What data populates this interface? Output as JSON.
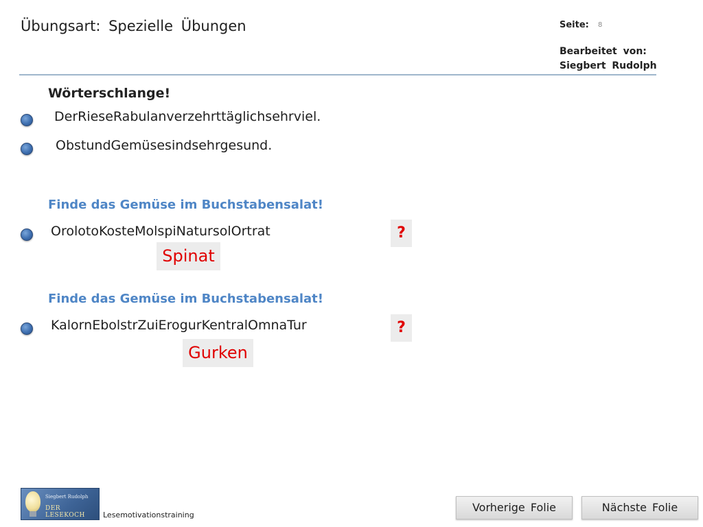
{
  "header": {
    "title": "Übungsart:  Spezielle  Übungen",
    "page_label": "Seite:",
    "page_number": "8",
    "edited_by_label": "Bearbeitet  von:",
    "editor_name": "Siegbert  Rudolph"
  },
  "section1": {
    "heading": "Wörterschlange!",
    "lines": [
      "DerRieseRabulanverzehrttäglichsehrviel.",
      "ObstundGemüsesindsehrgesund."
    ]
  },
  "section2": {
    "heading": "Finde das Gemüse im Buchstabensalat!",
    "puzzle": "OrolotoKosteMolspiNatursolOrtrat",
    "button": "?",
    "answer": "Spinat"
  },
  "section3": {
    "heading": "Finde das Gemüse im Buchstabensalat!",
    "puzzle": "KalornEbolstrZuiErogurKentralOmnaTur",
    "button": "?",
    "answer": "Gurken"
  },
  "footer": {
    "logo_small": "Siegbert Rudolph",
    "logo_brand": "DER LESEKOCH",
    "caption": "Lesemotivationstraining",
    "prev_button": "Vorherige  Folie",
    "next_button": "Nächste  Folie"
  },
  "colors": {
    "accent_blue": "#4f86c6",
    "answer_red": "#e00000",
    "rule": "#9fb6cc"
  }
}
